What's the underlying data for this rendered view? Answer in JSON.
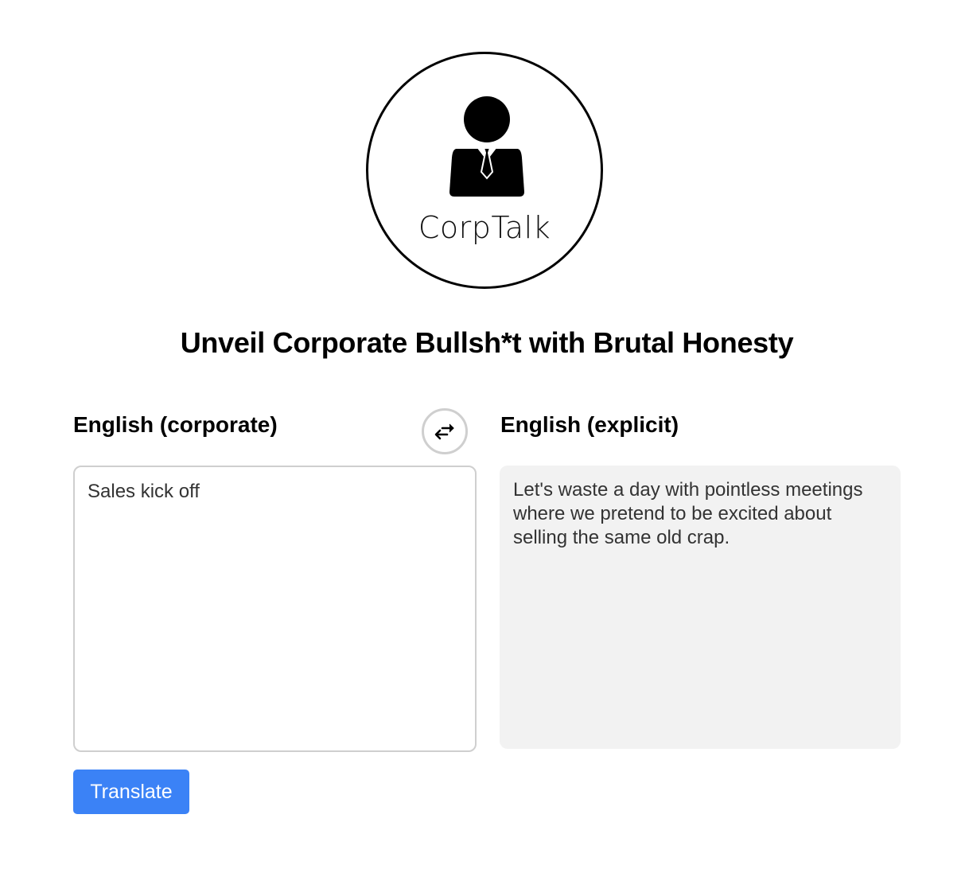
{
  "logo": {
    "wordmark": "CorpTalk",
    "icon": "businessman-icon"
  },
  "headline": "Unveil Corporate Bullsh*t with Brutal Honesty",
  "source": {
    "label": "English (corporate)",
    "value": "Sales kick off"
  },
  "swap": {
    "icon": "swap-arrows-icon"
  },
  "target": {
    "label": "English (explicit)",
    "text": "Let's waste a day with pointless meetings where we pretend to be excited about selling the same old crap."
  },
  "actions": {
    "translate_label": "Translate"
  },
  "colors": {
    "primary": "#3b82f6",
    "output_bg": "#f2f2f2",
    "border": "#cfcfcf"
  }
}
